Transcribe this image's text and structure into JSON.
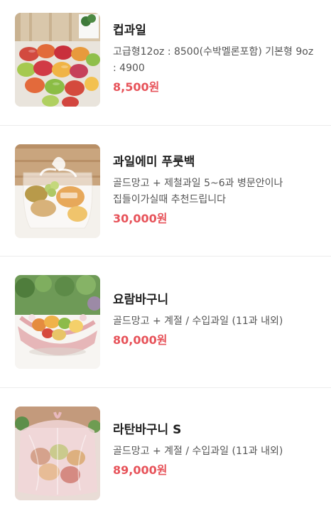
{
  "menu": {
    "items": [
      {
        "name": "컵과일",
        "description": "고급형12oz : 8500(수박멜론포함) 기본형 9oz : 4900",
        "price": "8,500원",
        "image": "cup-fruit-photo"
      },
      {
        "name": "과일에미 푸룻백",
        "description": "골드망고 + 제철과일 5~6과 병문안이나 집들이가실때 추천드립니다",
        "price": "30,000원",
        "image": "fruit-bag-photo"
      },
      {
        "name": "요람바구니",
        "description": "골드망고 + 계절 / 수입과일 (11과 내외)",
        "price": "80,000원",
        "image": "cradle-basket-photo"
      },
      {
        "name": "라탄바구니 S",
        "description": "골드망고 + 계절 / 수입과일 (11과 내외)",
        "price": "89,000원",
        "image": "rattan-basket-photo"
      }
    ]
  },
  "colors": {
    "price": "#e7535a",
    "divider": "#ececec"
  }
}
